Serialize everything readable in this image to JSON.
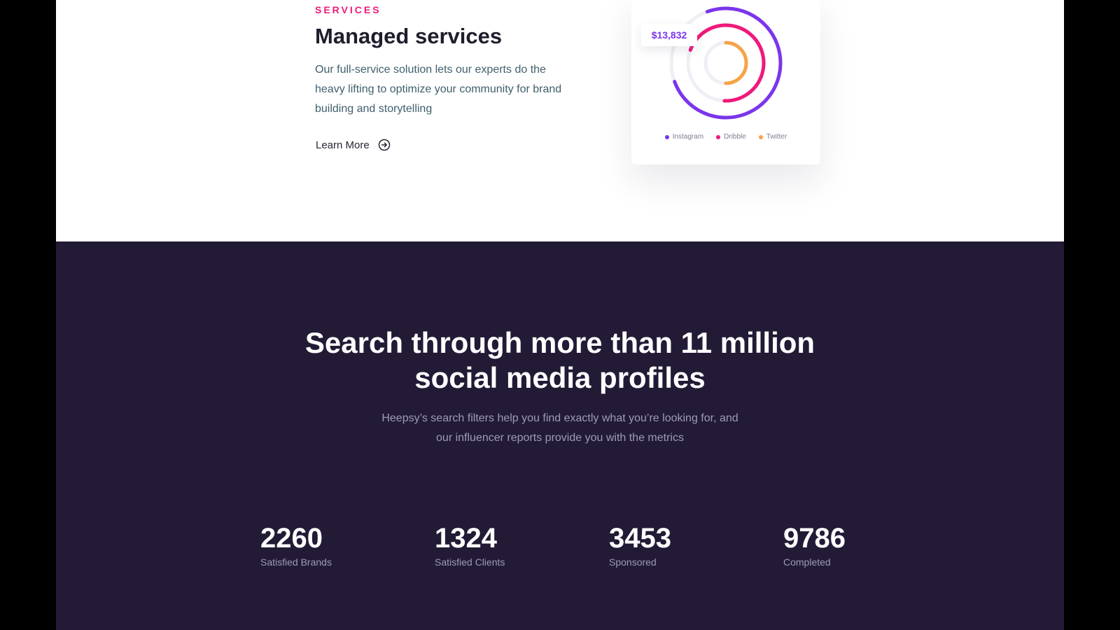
{
  "services": {
    "eyebrow": "SERVICES",
    "title": "Managed services",
    "description": "Our full-service solution lets our experts do the heavy lifting to optimize your community for brand building and storytelling",
    "learn_more": "Learn More"
  },
  "chart_card": {
    "price": "$13,832",
    "legend": [
      {
        "label": "Instagram",
        "color": "#7b35ec"
      },
      {
        "label": "Dribble",
        "color": "#f0197a"
      },
      {
        "label": "Twitter",
        "color": "#f7a348"
      }
    ],
    "rings": [
      {
        "name": "Instagram",
        "color": "#7b35ec",
        "fraction": 0.75
      },
      {
        "name": "Dribble",
        "color": "#f0197a",
        "fraction": 0.7
      },
      {
        "name": "Twitter",
        "color": "#f7a348",
        "fraction": 0.5
      }
    ]
  },
  "search": {
    "headline_line1": "Search through more than 11 million",
    "headline_line2": "social media profiles",
    "sub_line1": "Heepsy’s search filters help you find exactly what you’re looking for, and",
    "sub_line2": "our influencer reports provide you with the metrics"
  },
  "stats": [
    {
      "value": "2260",
      "label": "Satisfied Brands"
    },
    {
      "value": "1324",
      "label": "Satisfied Clients"
    },
    {
      "value": "3453",
      "label": "Sponsored"
    },
    {
      "value": "9786",
      "label": "Completed"
    }
  ]
}
